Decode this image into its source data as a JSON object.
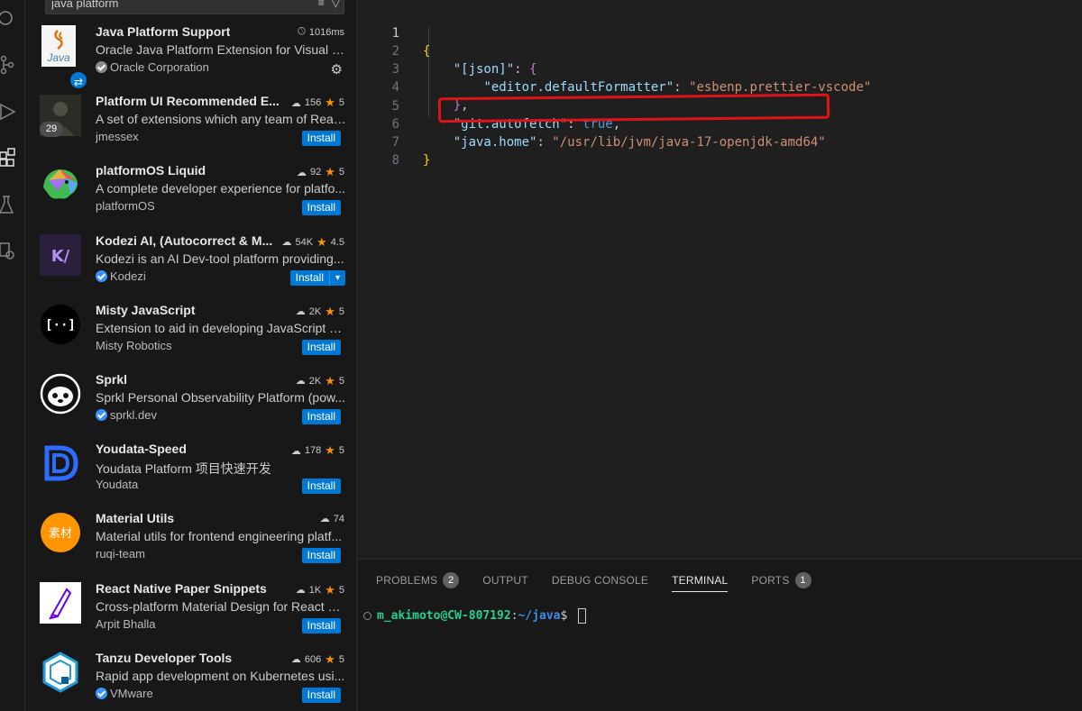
{
  "search": {
    "value": "java platform"
  },
  "extensions": [
    {
      "name": "Java Platform Support",
      "stat": "1016ms",
      "stat_icon": "clock-icon",
      "description": "Oracle Java Platform Extension for Visual St...",
      "publisher": "Oracle Corporation",
      "verified": true,
      "action": "gear",
      "logo": "java-logo"
    },
    {
      "name": "Platform UI Recommended E...",
      "downloads": "156",
      "rating": "5",
      "description": "A set of extensions which any team of Reac...",
      "publisher": "jmessex",
      "verified": false,
      "action": "Install",
      "logo": "avatar-photo",
      "badge": "29"
    },
    {
      "name": "platformOS Liquid",
      "downloads": "92",
      "rating": "5",
      "description": "A complete developer experience for platfo...",
      "publisher": "platformOS",
      "verified": false,
      "action": "Install",
      "logo": "chameleon-logo"
    },
    {
      "name": "Kodezi AI, (Autocorrect & M...",
      "downloads": "54K",
      "rating": "4.5",
      "description": "Kodezi is an AI Dev-tool platform providing...",
      "publisher": "Kodezi",
      "verified": true,
      "action": "Install",
      "logo": "kodezi-logo"
    },
    {
      "name": "Misty JavaScript",
      "downloads": "2K",
      "rating": "5",
      "description": "Extension to aid in developing JavaScript sk...",
      "publisher": "Misty Robotics",
      "verified": false,
      "action": "Install",
      "logo": "misty-logo"
    },
    {
      "name": "Sprkl",
      "downloads": "2K",
      "rating": "5",
      "description": "Sprkl Personal Observability Platform (pow...",
      "publisher": "sprkl.dev",
      "verified": true,
      "action": "Install",
      "logo": "sloth-logo"
    },
    {
      "name": "Youdata-Speed",
      "downloads": "178",
      "rating": "5",
      "description": "Youdata Platform 项目快速开发",
      "publisher": "Youdata",
      "verified": false,
      "action": "Install",
      "logo": "youdata-logo"
    },
    {
      "name": "Material Utils",
      "downloads": "74",
      "rating": "",
      "description": "Material utils for frontend engineering platf...",
      "publisher": "ruqi-team",
      "verified": false,
      "action": "Install",
      "logo": "material-logo",
      "logo_text": "素材"
    },
    {
      "name": "React Native Paper Snippets",
      "downloads": "1K",
      "rating": "5",
      "description": "Cross-platform Material Design for React N...",
      "publisher": "Arpit Bhalla",
      "verified": false,
      "action": "Install",
      "logo": "rn-paper-logo"
    },
    {
      "name": "Tanzu Developer Tools",
      "downloads": "606",
      "rating": "5",
      "description": "Rapid app development on Kubernetes usi...",
      "publisher": "VMware",
      "verified": true,
      "action": "Install",
      "logo": "tanzu-logo"
    }
  ],
  "editor": {
    "line_numbers": [
      "1",
      "2",
      "3",
      "4",
      "5",
      "6",
      "7",
      "8"
    ],
    "active_line": 1
  },
  "code_tokens": {
    "l2_key": "\"[json]\"",
    "l3_key": "\"editor.defaultFormatter\"",
    "l3_val": "\"esbenp.prettier-vscode\"",
    "l5_key": "\"git.autofetch\"",
    "l5_val": "true",
    "l6_key": "\"java.home\"",
    "l6_val": "\"/usr/lib/jvm/java-17-openjdk-amd64\""
  },
  "panel": {
    "tabs": [
      {
        "label": "PROBLEMS",
        "badge": "2"
      },
      {
        "label": "OUTPUT"
      },
      {
        "label": "DEBUG CONSOLE"
      },
      {
        "label": "TERMINAL",
        "active": true
      },
      {
        "label": "PORTS",
        "badge": "1"
      }
    ]
  },
  "terminal": {
    "user_host": "m_akimoto@CW-807192",
    "colon": ":",
    "path": "~/java",
    "prompt": "$ "
  },
  "colors": {
    "accent": "#0078d4",
    "highlight_box": "#e0121a",
    "star": "#ff8e00"
  }
}
